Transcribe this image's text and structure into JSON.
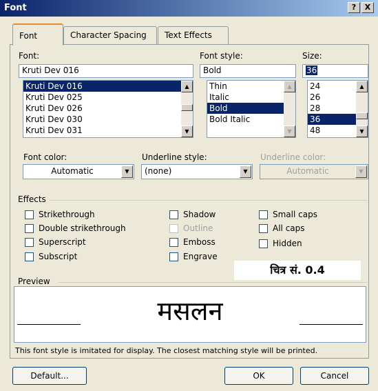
{
  "window": {
    "title": "Font",
    "help_btn": "?",
    "close_btn": "X"
  },
  "tabs": [
    {
      "label": "Font",
      "active": true
    },
    {
      "label": "Character Spacing",
      "active": false
    },
    {
      "label": "Text Effects",
      "active": false
    }
  ],
  "font": {
    "label": "Font:",
    "value": "Kruti Dev 016",
    "options": [
      "Kruti Dev 016",
      "Kruti Dev 025",
      "Kruti Dev 026",
      "Kruti Dev 030",
      "Kruti Dev 031"
    ],
    "selected": "Kruti Dev 016"
  },
  "style": {
    "label": "Font style:",
    "value": "Bold",
    "options": [
      "Thin",
      "Italic",
      "Bold",
      "Bold Italic"
    ],
    "selected": "Bold"
  },
  "size": {
    "label": "Size:",
    "value": "36",
    "options": [
      "24",
      "26",
      "28",
      "36",
      "48"
    ],
    "selected": "36"
  },
  "font_color": {
    "label": "Font color:",
    "value": "Automatic"
  },
  "underline_style": {
    "label": "Underline style:",
    "value": "(none)"
  },
  "underline_color": {
    "label": "Underline color:",
    "value": "Automatic",
    "disabled": true
  },
  "effects": {
    "label": "Effects",
    "items": [
      {
        "label": "Strikethrough",
        "checked": false,
        "disabled": false
      },
      {
        "label": "Double strikethrough",
        "checked": false,
        "disabled": false
      },
      {
        "label": "Superscript",
        "checked": false,
        "disabled": false
      },
      {
        "label": "Subscript",
        "checked": false,
        "disabled": false
      },
      {
        "label": "Shadow",
        "checked": false,
        "disabled": false
      },
      {
        "label": "Outline",
        "checked": false,
        "disabled": true
      },
      {
        "label": "Emboss",
        "checked": false,
        "disabled": false
      },
      {
        "label": "Engrave",
        "checked": false,
        "disabled": false
      },
      {
        "label": "Small caps",
        "checked": false,
        "disabled": false
      },
      {
        "label": "All caps",
        "checked": false,
        "disabled": false
      },
      {
        "label": "Hidden",
        "checked": false,
        "disabled": false
      }
    ]
  },
  "figure_caption": "चित्र सं. 0.4",
  "preview": {
    "label": "Preview",
    "sample_text": "मसलन",
    "note": "This font style is imitated for display. The closest matching style will be printed."
  },
  "buttons": {
    "default": "Default...",
    "ok": "OK",
    "cancel": "Cancel"
  },
  "colors": {
    "titlebar": "#0a246a",
    "selection": "#0a246a",
    "dialog_bg": "#ece9d8"
  }
}
